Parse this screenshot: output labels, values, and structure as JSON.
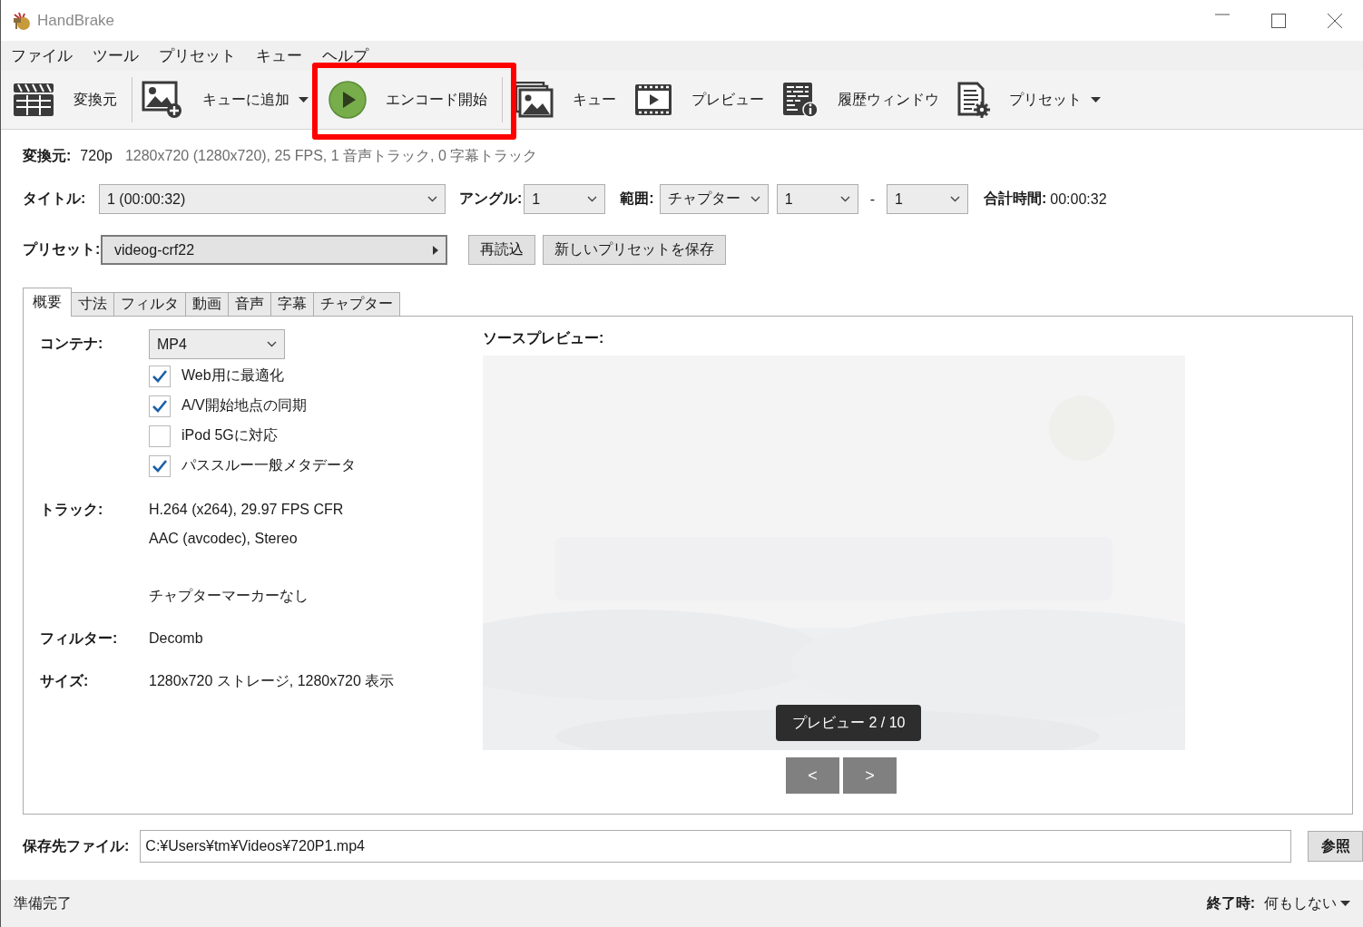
{
  "window": {
    "title": "HandBrake"
  },
  "menu": [
    "ファイル",
    "ツール",
    "プリセット",
    "キュー",
    "ヘルプ"
  ],
  "toolbar": [
    {
      "kind": "source",
      "label": "変換元",
      "dropdown": false,
      "highlighted": false
    },
    {
      "kind": "add_queue",
      "label": "キューに追加",
      "dropdown": true,
      "highlighted": false
    },
    {
      "kind": "start",
      "label": "エンコード開始",
      "dropdown": false,
      "highlighted": true
    },
    {
      "kind": "queue",
      "label": "キュー",
      "dropdown": false,
      "highlighted": false
    },
    {
      "kind": "preview",
      "label": "プレビュー",
      "dropdown": false,
      "highlighted": false
    },
    {
      "kind": "log",
      "label": "履歴ウィンドウ",
      "dropdown": false,
      "highlighted": false
    },
    {
      "kind": "presets",
      "label": "プリセット",
      "dropdown": true,
      "highlighted": false
    }
  ],
  "source": {
    "label": "変換元:",
    "name": "720p",
    "info": "1280x720 (1280x720), 25 FPS, 1 音声トラック, 0 字幕トラック"
  },
  "title_row": {
    "title_label": "タイトル:",
    "title_value": "1  (00:00:32)",
    "angle_label": "アングル:",
    "angle_value": "1",
    "range_label": "範囲:",
    "range_mode": "チャプター",
    "range_start": "1",
    "range_separator": "-",
    "range_end": "1",
    "duration_label": "合計時間:",
    "duration_value": "00:00:32"
  },
  "preset_row": {
    "label": "プリセット:",
    "value": "videog-crf22",
    "buttons": [
      "再読込",
      "新しいプリセットを保存"
    ]
  },
  "tabs": [
    {
      "label": "概要",
      "selected": true
    },
    {
      "label": "寸法",
      "selected": false
    },
    {
      "label": "フィルタ",
      "selected": false
    },
    {
      "label": "動画",
      "selected": false
    },
    {
      "label": "音声",
      "selected": false
    },
    {
      "label": "字幕",
      "selected": false
    },
    {
      "label": "チャプター",
      "selected": false
    }
  ],
  "summary": {
    "container_label": "コンテナ:",
    "container_value": "MP4",
    "options": [
      {
        "label": "Web用に最適化",
        "checked": true
      },
      {
        "label": "A/V開始地点の同期",
        "checked": true
      },
      {
        "label": "iPod 5Gに対応",
        "checked": false
      },
      {
        "label": "パススルー一般メタデータ",
        "checked": true
      }
    ],
    "rows": [
      {
        "label": "トラック:",
        "lines": [
          "H.264 (x264), 29.97 FPS CFR",
          "AAC (avcodec), Stereo"
        ]
      },
      {
        "lines": [
          "チャプターマーカーなし"
        ]
      },
      {
        "label": "フィルター:",
        "lines": [
          "Decomb"
        ]
      },
      {
        "label": "サイズ:",
        "lines": [
          "1280x720 ストレージ, 1280x720 表示"
        ]
      }
    ]
  },
  "preview": {
    "label": "ソースプレビュー:",
    "kind": "picture",
    "badge": "プレビュー 2 / 10",
    "prev": "<",
    "next": ">"
  },
  "destination": {
    "label": "保存先ファイル:",
    "value": "C:¥Users¥tm¥Videos¥720P1.mp4",
    "browse": "参照"
  },
  "status_bar": {
    "text": "準備完了",
    "when_done_label": "終了時:",
    "when_done_value": "何もしない"
  }
}
